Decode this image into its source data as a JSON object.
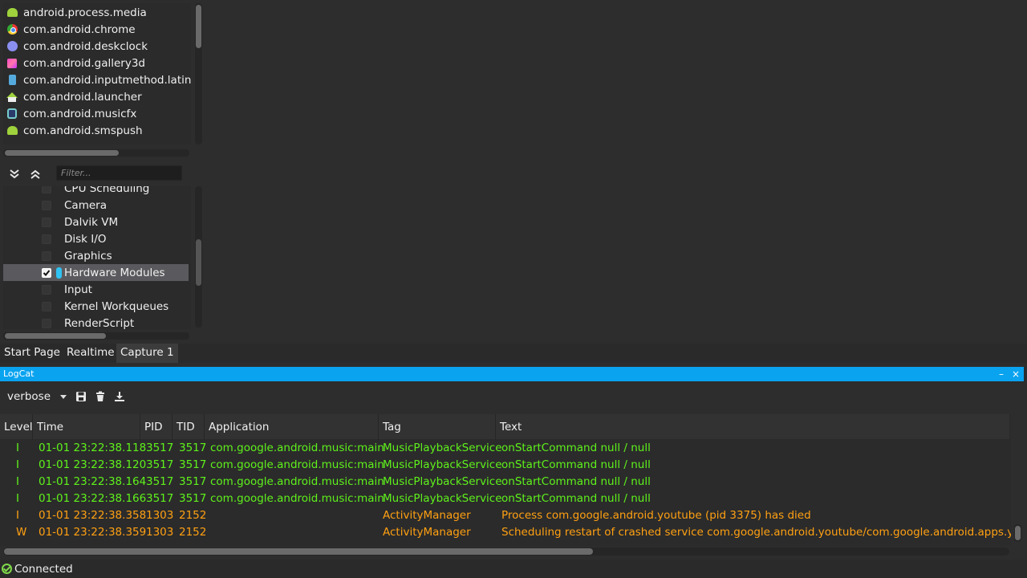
{
  "processes": {
    "items": [
      {
        "label": "android.process.media",
        "icon": "android-icon"
      },
      {
        "label": "com.android.chrome",
        "icon": "chrome-icon"
      },
      {
        "label": "com.android.deskclock",
        "icon": "clock-icon"
      },
      {
        "label": "com.android.gallery3d",
        "icon": "gallery-icon"
      },
      {
        "label": "com.android.inputmethod.latin",
        "icon": "keyboard-icon"
      },
      {
        "label": "com.android.launcher",
        "icon": "launcher-icon"
      },
      {
        "label": "com.android.musicfx",
        "icon": "musicfx-icon"
      },
      {
        "label": "com.android.smspush",
        "icon": "android-icon"
      }
    ]
  },
  "filter": {
    "placeholder": "Filter...",
    "expand_icon": "expand-all-icon",
    "collapse_icon": "collapse-all-icon"
  },
  "categories": {
    "items": [
      {
        "label": "CPU Scheduling",
        "checked": false
      },
      {
        "label": "Camera",
        "checked": false
      },
      {
        "label": "Dalvik VM",
        "checked": false
      },
      {
        "label": "Disk I/O",
        "checked": false
      },
      {
        "label": "Graphics",
        "checked": false
      },
      {
        "label": "Hardware Modules",
        "checked": true,
        "selected": true
      },
      {
        "label": "Input",
        "checked": false
      },
      {
        "label": "Kernel Workqueues",
        "checked": false
      },
      {
        "label": "RenderScript",
        "checked": false
      }
    ],
    "marker_color": "#2fc3f3"
  },
  "tabs": {
    "start_page": "Start Page",
    "realtime": "Realtime",
    "capture": "Capture 1",
    "active": "capture"
  },
  "logcat": {
    "title": "LogCat",
    "minimize_label": "–",
    "close_label": "×",
    "level": "verbose",
    "toolbar_icons": [
      "save-icon",
      "trash-icon",
      "download-icon"
    ],
    "accent_color": "#0aa3f0",
    "columns": {
      "level": "Level",
      "time": "Time",
      "pid": "PID",
      "tid": "TID",
      "application": "Application",
      "tag": "Tag",
      "text": "Text"
    },
    "rows": [
      {
        "level": "I",
        "time": "01-01 23:22:38.118",
        "pid": "3517",
        "tid": "3517",
        "application": "com.google.android.music:main",
        "tag": "MusicPlaybackService",
        "text": "onStartCommand null / null",
        "kind": "info"
      },
      {
        "level": "I",
        "time": "01-01 23:22:38.120",
        "pid": "3517",
        "tid": "3517",
        "application": "com.google.android.music:main",
        "tag": "MusicPlaybackService",
        "text": "onStartCommand null / null",
        "kind": "info"
      },
      {
        "level": "I",
        "time": "01-01 23:22:38.164",
        "pid": "3517",
        "tid": "3517",
        "application": "com.google.android.music:main",
        "tag": "MusicPlaybackService",
        "text": "onStartCommand null / null",
        "kind": "info"
      },
      {
        "level": "I",
        "time": "01-01 23:22:38.166",
        "pid": "3517",
        "tid": "3517",
        "application": "com.google.android.music:main",
        "tag": "MusicPlaybackService",
        "text": "onStartCommand null / null",
        "kind": "info"
      },
      {
        "level": "I",
        "time": "01-01 23:22:38.358",
        "pid": "1303",
        "tid": "2152",
        "application": "",
        "tag": "ActivityManager",
        "text": "Process com.google.android.youtube (pid 3375) has died",
        "kind": "warn"
      },
      {
        "level": "W",
        "time": "01-01 23:22:38.359",
        "pid": "1303",
        "tid": "2152",
        "application": "",
        "tag": "ActivityManager",
        "text": "Scheduling restart of crashed service com.google.android.youtube/com.google.android.apps.youtu",
        "kind": "warn"
      }
    ],
    "info_color": "#5ef21b",
    "warn_color": "#ffa012"
  },
  "status": {
    "text": "Connected",
    "icon": "connected-check-icon"
  }
}
